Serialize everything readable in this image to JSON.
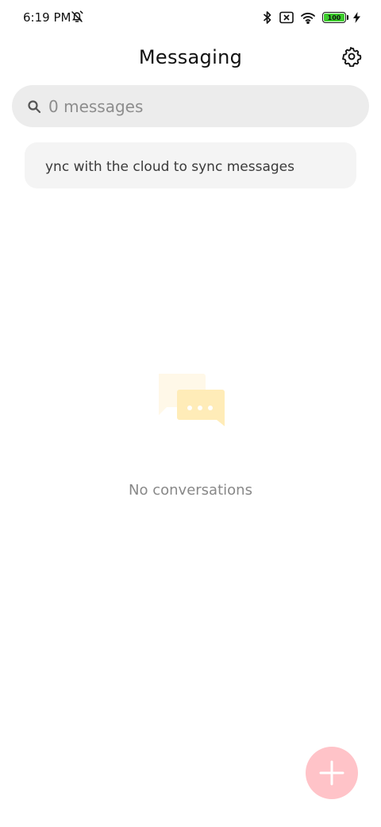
{
  "status": {
    "time": "6:19 PM",
    "battery": "100"
  },
  "header": {
    "title": "Messaging"
  },
  "search": {
    "placeholder": "0 messages"
  },
  "sync": {
    "text": "ync with the cloud to sync messages"
  },
  "empty": {
    "text": "No conversations"
  },
  "colors": {
    "fab": "#ffc3c8",
    "battery_fill": "#3ccc2c",
    "search_bg": "#ececec",
    "banner_bg": "#f4f4f4"
  },
  "icons": {
    "status": [
      "alarm-off-icon",
      "bluetooth-icon",
      "sim-card-off-icon",
      "wifi-icon",
      "battery-icon",
      "charging-icon"
    ],
    "header": "gear-icon",
    "search": "search-icon",
    "empty": "chat-bubbles-icon",
    "fab": "plus-icon"
  }
}
